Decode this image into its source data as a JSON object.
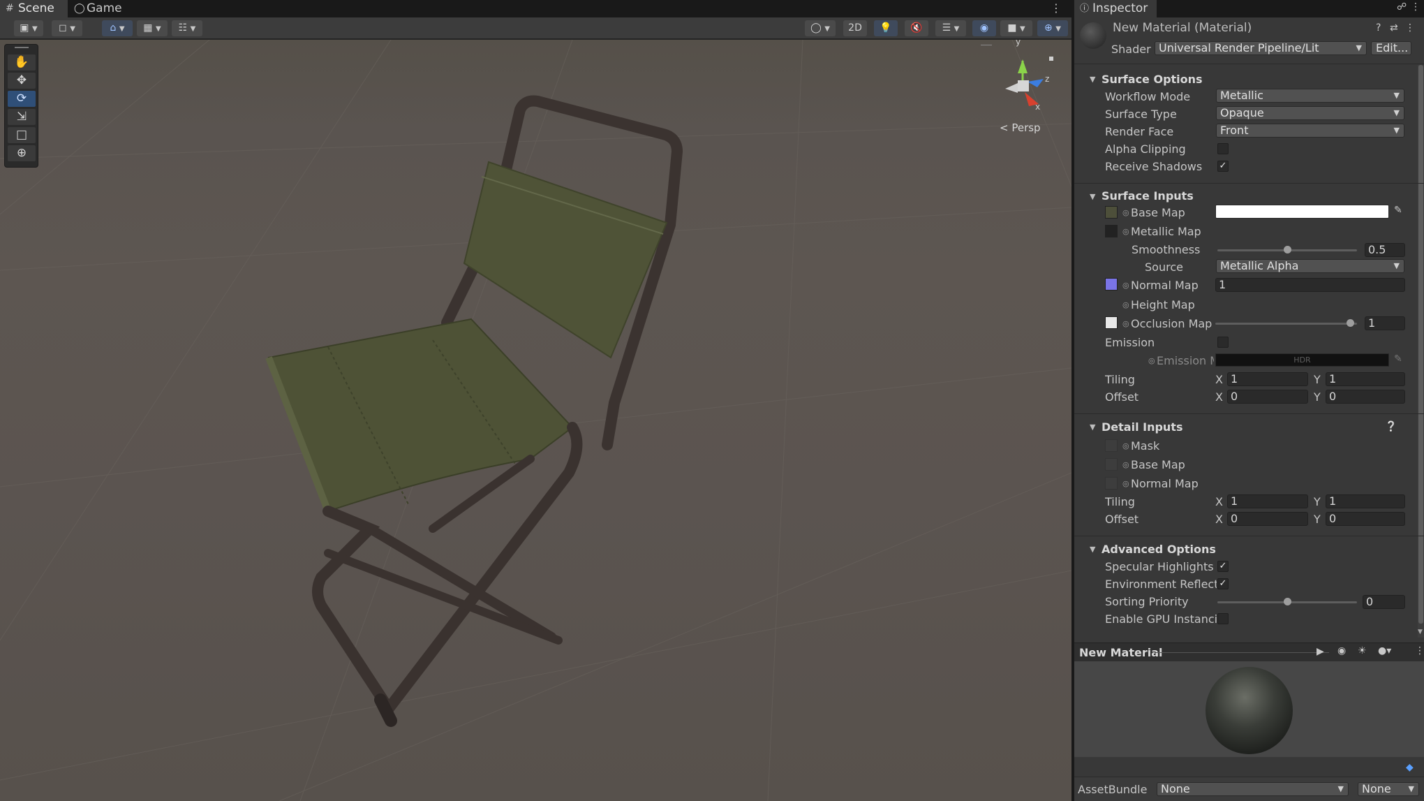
{
  "scene_tabs": {
    "scene": "Scene",
    "game": "Game"
  },
  "scene_toolbar": {
    "mode_2d": "2D"
  },
  "gizmo": {
    "axis_y": "y",
    "axis_z": "z",
    "axis_x": "x",
    "projection": "< Persp"
  },
  "colors": {
    "accent": "#2f4f78",
    "panel": "#383838",
    "viewport": "#5a5450",
    "chair_fabric": "#4e5236",
    "chair_frame": "#3a322f"
  },
  "inspector": {
    "tab": "Inspector",
    "material_title": "New Material (Material)",
    "shader_label": "Shader",
    "shader_value": "Universal Render Pipeline/Lit",
    "edit_button": "Edit...",
    "surface_options": {
      "title": "Surface Options",
      "workflow_mode_label": "Workflow Mode",
      "workflow_mode_value": "Metallic",
      "surface_type_label": "Surface Type",
      "surface_type_value": "Opaque",
      "render_face_label": "Render Face",
      "render_face_value": "Front",
      "alpha_clipping_label": "Alpha Clipping",
      "receive_shadows_label": "Receive Shadows"
    },
    "surface_inputs": {
      "title": "Surface Inputs",
      "base_map_label": "Base Map",
      "metallic_map_label": "Metallic Map",
      "smoothness_label": "Smoothness",
      "smoothness_value": "0.5",
      "source_label": "Source",
      "source_value": "Metallic Alpha",
      "normal_map_label": "Normal Map",
      "normal_map_value": "1",
      "height_map_label": "Height Map",
      "occlusion_map_label": "Occlusion Map",
      "occlusion_value": "1",
      "emission_label": "Emission",
      "emission_map_label": "Emission M",
      "emission_hdr": "HDR",
      "tiling_label": "Tiling",
      "tiling_x": "1",
      "tiling_y": "1",
      "offset_label": "Offset",
      "offset_x": "0",
      "offset_y": "0",
      "x_label": "X",
      "y_label": "Y"
    },
    "detail_inputs": {
      "title": "Detail Inputs",
      "mask_label": "Mask",
      "base_map_label": "Base Map",
      "normal_map_label": "Normal Map",
      "tiling_label": "Tiling",
      "tiling_x": "1",
      "tiling_y": "1",
      "offset_label": "Offset",
      "offset_x": "0",
      "offset_y": "0"
    },
    "advanced_options": {
      "title": "Advanced Options",
      "specular_label": "Specular Highlights",
      "env_reflections_label": "Environment Reflectio",
      "sorting_priority_label": "Sorting Priority",
      "sorting_priority_value": "0",
      "gpu_instancing_label": "Enable GPU Instancinç"
    },
    "preview": {
      "title": "New Material"
    },
    "assetbundle": {
      "label": "AssetBundle",
      "value1": "None",
      "value2": "None"
    }
  },
  "sliders": {
    "smoothness": 0.5,
    "occlusion": 1.0,
    "sorting_priority": 0.5
  }
}
